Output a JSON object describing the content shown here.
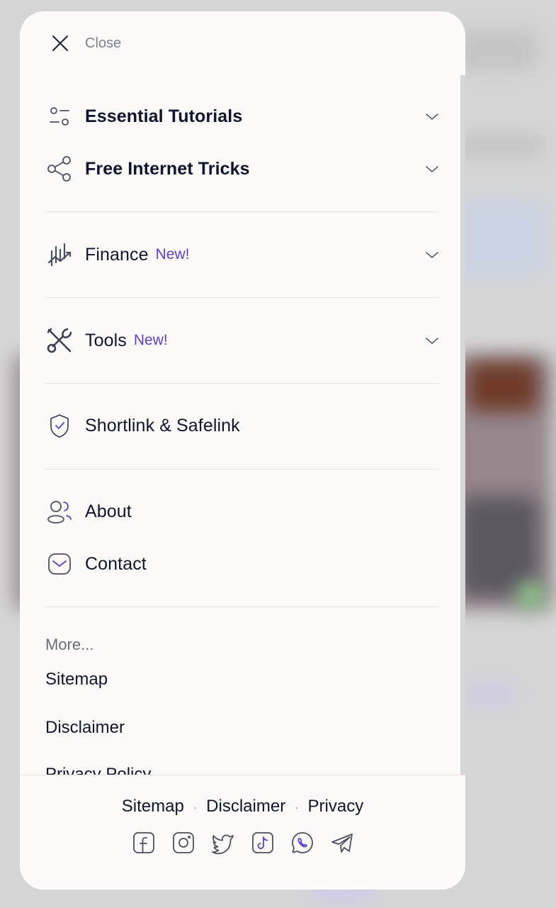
{
  "close": {
    "label": "Close"
  },
  "menu": {
    "essential_tutorials": {
      "label": "Essential Tutorials"
    },
    "free_internet_tricks": {
      "label": "Free Internet Tricks"
    },
    "finance": {
      "label": "Finance",
      "badge": "New!"
    },
    "tools": {
      "label": "Tools",
      "badge": "New!"
    },
    "shortlink": {
      "label": "Shortlink & Safelink"
    },
    "about": {
      "label": "About"
    },
    "contact": {
      "label": "Contact"
    }
  },
  "more": {
    "heading": "More...",
    "links": [
      "Sitemap",
      "Disclaimer",
      "Privacy Policy"
    ]
  },
  "footer": {
    "links": [
      "Sitemap",
      "Disclaimer",
      "Privacy"
    ],
    "separator": "·",
    "socials": [
      "facebook-icon",
      "instagram-icon",
      "twitter-icon",
      "tiktok-icon",
      "whatsapp-icon",
      "telegram-icon"
    ]
  },
  "colors": {
    "accent": "#5a3fd6",
    "text": "#0f1530",
    "panel": "#fcfbf9"
  }
}
